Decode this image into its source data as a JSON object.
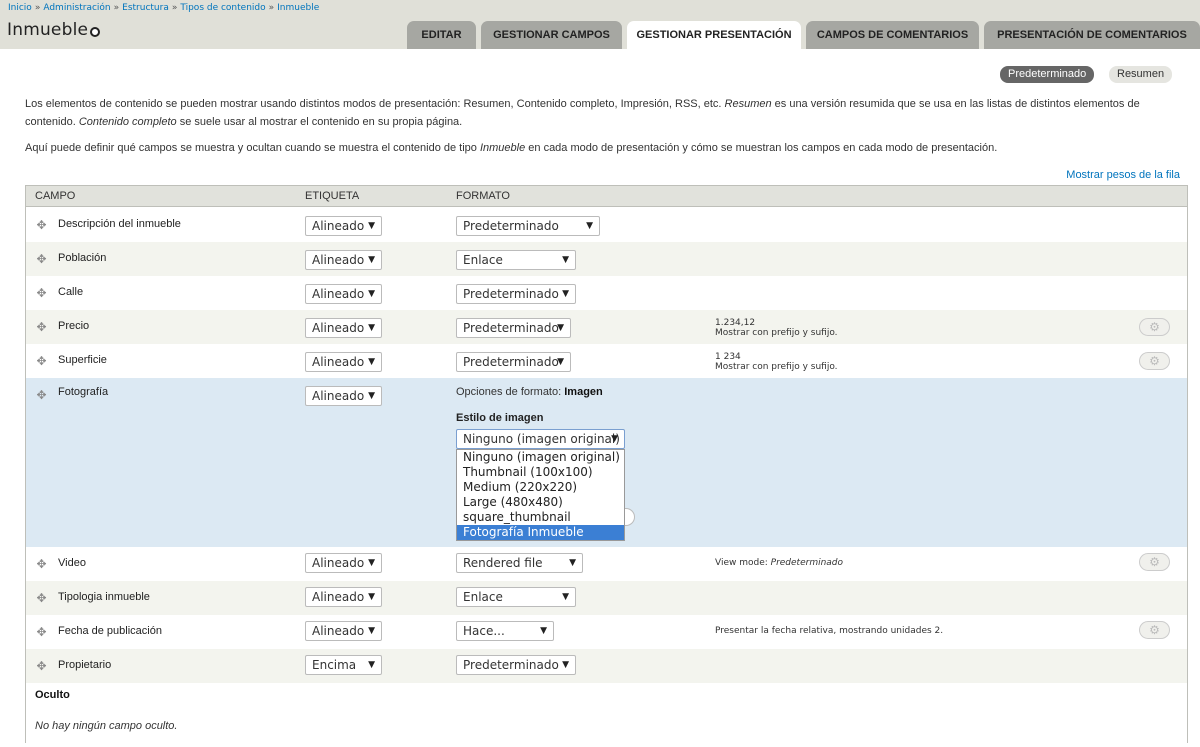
{
  "breadcrumb": [
    "Inicio",
    "Administración",
    "Estructura",
    "Tipos de contenido",
    "Inmueble"
  ],
  "page_title": "Inmueble",
  "tabs": [
    "Editar",
    "Gestionar campos",
    "Gestionar presentación",
    "Campos de comentarios",
    "Presentación de comentarios"
  ],
  "active_tab": "Gestionar presentación",
  "display_modes": {
    "default": "Predeterminado",
    "teaser": "Resumen"
  },
  "description": {
    "p1_a": "Los elementos de contenido se pueden mostrar usando distintos modos de presentación: Resumen, Contenido completo, Impresión, RSS, etc. ",
    "p1_i1": "Resumen",
    "p1_b": " es una versión resumida que se usa en las listas de distintos elementos de",
    "p1_c": "contenido. ",
    "p1_i2": "Contenido completo",
    "p1_d": " se suele usar al mostrar el contenido en su propia página.",
    "p2_a": "Aquí puede definir qué campos se muestra y ocultan cuando se muestra el contenido de tipo ",
    "p2_i": "Inmueble",
    "p2_b": " en cada modo de presentación y cómo se muestran los campos en cada modo de presentación."
  },
  "show_weights_link": "Mostrar pesos de la fila",
  "table": {
    "headers": [
      "Campo",
      "Etiqueta",
      "Formato"
    ],
    "rows": [
      {
        "name": "Descripción del inmueble",
        "label": "Alineado",
        "format": "Predeterminado",
        "summary1": "",
        "summary2": ""
      },
      {
        "name": "Población",
        "label": "Alineado",
        "format": "Enlace",
        "summary1": "",
        "summary2": ""
      },
      {
        "name": "Calle",
        "label": "Alineado",
        "format": "Predeterminado",
        "summary1": "",
        "summary2": ""
      },
      {
        "name": "Precio",
        "label": "Alineado",
        "format": "Predeterminado",
        "summary1": "1.234,12",
        "summary2": "Mostrar con prefijo y sufijo."
      },
      {
        "name": "Superficie",
        "label": "Alineado",
        "format": "Predeterminado",
        "summary1": "1 234",
        "summary2": "Mostrar con prefijo y sufijo."
      },
      {
        "name": "Fotografía",
        "label": "Alineado",
        "format": "",
        "summary1": "",
        "summary2": ""
      },
      {
        "name": "Video",
        "label": "Alineado",
        "format": "Rendered file",
        "summary1": "View mode: ",
        "summary1_i": "Predeterminado",
        "summary2": ""
      },
      {
        "name": "Tipologia inmueble",
        "label": "Alineado",
        "format": "Enlace",
        "summary1": "",
        "summary2": ""
      },
      {
        "name": "Fecha de publicación",
        "label": "Alineado",
        "format": "Hace...",
        "summary1": "Presentar la fecha relativa, mostrando unidades 2.",
        "summary2": ""
      },
      {
        "name": "Propietario",
        "label": "Encima",
        "format": "Predeterminado",
        "summary1": "",
        "summary2": ""
      }
    ],
    "photo_settings": {
      "format_options_prefix": "Opciones de formato: ",
      "format_options_value": "Imagen",
      "image_style_label": "Estilo de imagen",
      "image_style_selected": "Ninguno (imagen original)",
      "image_style_options": [
        "Ninguno (imagen original)",
        "Thumbnail (100x100)",
        "Medium (220x220)",
        "Large (480x480)",
        "square_thumbnail",
        "Fotografía Inmueble"
      ],
      "highlighted_option": "Fotografía Inmueble"
    },
    "hidden_region_title": "Oculto",
    "hidden_region_empty": "No hay ningún campo oculto."
  },
  "icons": {
    "shortcut": "shortcut-star-icon",
    "drag": "drag-handle-icon",
    "settings": "gear-icon",
    "dropdown": "dropdown-arrow-icon"
  },
  "colors": {
    "link": "#0074bd",
    "header_bg": "#e0e0d8",
    "tab_bg": "#a6a7a2",
    "highlight_row": "#dce9f3",
    "selected_option": "#3b7fd4"
  }
}
